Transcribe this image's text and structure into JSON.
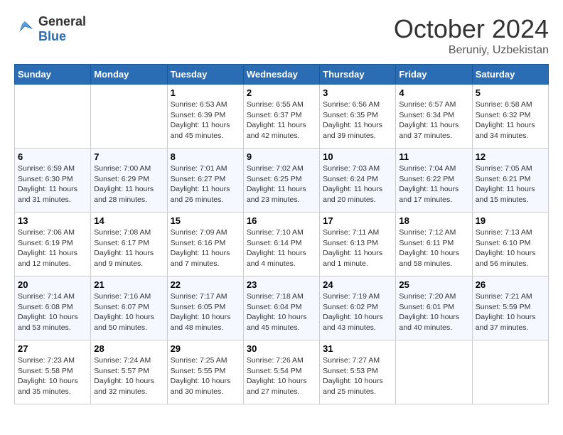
{
  "header": {
    "logo_general": "General",
    "logo_blue": "Blue",
    "month_title": "October 2024",
    "location": "Beruniy, Uzbekistan"
  },
  "days_of_week": [
    "Sunday",
    "Monday",
    "Tuesday",
    "Wednesday",
    "Thursday",
    "Friday",
    "Saturday"
  ],
  "weeks": [
    [
      null,
      null,
      {
        "day": 1,
        "sunrise": "6:53 AM",
        "sunset": "6:39 PM",
        "daylight": "11 hours and 45 minutes."
      },
      {
        "day": 2,
        "sunrise": "6:55 AM",
        "sunset": "6:37 PM",
        "daylight": "11 hours and 42 minutes."
      },
      {
        "day": 3,
        "sunrise": "6:56 AM",
        "sunset": "6:35 PM",
        "daylight": "11 hours and 39 minutes."
      },
      {
        "day": 4,
        "sunrise": "6:57 AM",
        "sunset": "6:34 PM",
        "daylight": "11 hours and 37 minutes."
      },
      {
        "day": 5,
        "sunrise": "6:58 AM",
        "sunset": "6:32 PM",
        "daylight": "11 hours and 34 minutes."
      }
    ],
    [
      {
        "day": 6,
        "sunrise": "6:59 AM",
        "sunset": "6:30 PM",
        "daylight": "11 hours and 31 minutes."
      },
      {
        "day": 7,
        "sunrise": "7:00 AM",
        "sunset": "6:29 PM",
        "daylight": "11 hours and 28 minutes."
      },
      {
        "day": 8,
        "sunrise": "7:01 AM",
        "sunset": "6:27 PM",
        "daylight": "11 hours and 26 minutes."
      },
      {
        "day": 9,
        "sunrise": "7:02 AM",
        "sunset": "6:25 PM",
        "daylight": "11 hours and 23 minutes."
      },
      {
        "day": 10,
        "sunrise": "7:03 AM",
        "sunset": "6:24 PM",
        "daylight": "11 hours and 20 minutes."
      },
      {
        "day": 11,
        "sunrise": "7:04 AM",
        "sunset": "6:22 PM",
        "daylight": "11 hours and 17 minutes."
      },
      {
        "day": 12,
        "sunrise": "7:05 AM",
        "sunset": "6:21 PM",
        "daylight": "11 hours and 15 minutes."
      }
    ],
    [
      {
        "day": 13,
        "sunrise": "7:06 AM",
        "sunset": "6:19 PM",
        "daylight": "11 hours and 12 minutes."
      },
      {
        "day": 14,
        "sunrise": "7:08 AM",
        "sunset": "6:17 PM",
        "daylight": "11 hours and 9 minutes."
      },
      {
        "day": 15,
        "sunrise": "7:09 AM",
        "sunset": "6:16 PM",
        "daylight": "11 hours and 7 minutes."
      },
      {
        "day": 16,
        "sunrise": "7:10 AM",
        "sunset": "6:14 PM",
        "daylight": "11 hours and 4 minutes."
      },
      {
        "day": 17,
        "sunrise": "7:11 AM",
        "sunset": "6:13 PM",
        "daylight": "11 hours and 1 minute."
      },
      {
        "day": 18,
        "sunrise": "7:12 AM",
        "sunset": "6:11 PM",
        "daylight": "10 hours and 58 minutes."
      },
      {
        "day": 19,
        "sunrise": "7:13 AM",
        "sunset": "6:10 PM",
        "daylight": "10 hours and 56 minutes."
      }
    ],
    [
      {
        "day": 20,
        "sunrise": "7:14 AM",
        "sunset": "6:08 PM",
        "daylight": "10 hours and 53 minutes."
      },
      {
        "day": 21,
        "sunrise": "7:16 AM",
        "sunset": "6:07 PM",
        "daylight": "10 hours and 50 minutes."
      },
      {
        "day": 22,
        "sunrise": "7:17 AM",
        "sunset": "6:05 PM",
        "daylight": "10 hours and 48 minutes."
      },
      {
        "day": 23,
        "sunrise": "7:18 AM",
        "sunset": "6:04 PM",
        "daylight": "10 hours and 45 minutes."
      },
      {
        "day": 24,
        "sunrise": "7:19 AM",
        "sunset": "6:02 PM",
        "daylight": "10 hours and 43 minutes."
      },
      {
        "day": 25,
        "sunrise": "7:20 AM",
        "sunset": "6:01 PM",
        "daylight": "10 hours and 40 minutes."
      },
      {
        "day": 26,
        "sunrise": "7:21 AM",
        "sunset": "5:59 PM",
        "daylight": "10 hours and 37 minutes."
      }
    ],
    [
      {
        "day": 27,
        "sunrise": "7:23 AM",
        "sunset": "5:58 PM",
        "daylight": "10 hours and 35 minutes."
      },
      {
        "day": 28,
        "sunrise": "7:24 AM",
        "sunset": "5:57 PM",
        "daylight": "10 hours and 32 minutes."
      },
      {
        "day": 29,
        "sunrise": "7:25 AM",
        "sunset": "5:55 PM",
        "daylight": "10 hours and 30 minutes."
      },
      {
        "day": 30,
        "sunrise": "7:26 AM",
        "sunset": "5:54 PM",
        "daylight": "10 hours and 27 minutes."
      },
      {
        "day": 31,
        "sunrise": "7:27 AM",
        "sunset": "5:53 PM",
        "daylight": "10 hours and 25 minutes."
      },
      null,
      null
    ]
  ]
}
